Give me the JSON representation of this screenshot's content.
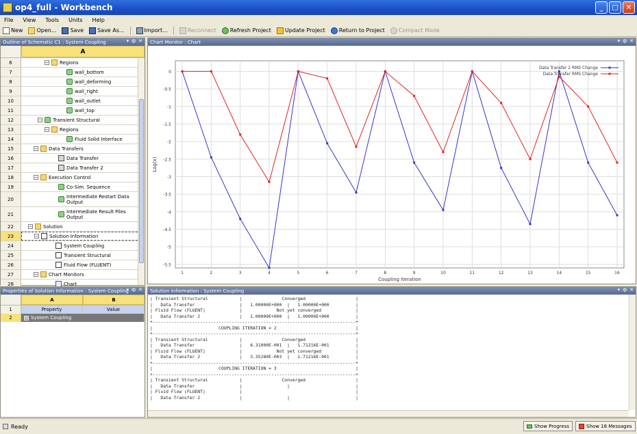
{
  "window": {
    "title": "op4_full - Workbench",
    "minimize": "_",
    "maximize": "□",
    "close": "✕"
  },
  "menu": [
    "File",
    "View",
    "Tools",
    "Units",
    "Help"
  ],
  "toolbar": {
    "new": "New",
    "open": "Open...",
    "save": "Save",
    "save_as": "Save As...",
    "import": "Import...",
    "reconnect": "Reconnect",
    "refresh": "Refresh Project",
    "update": "Update Project",
    "return": "Return to Project",
    "compact": "Compact Mode"
  },
  "outline": {
    "title": "Outline of Schematic C1 : System Coupling",
    "col": "A",
    "rows": [
      {
        "num": "6",
        "label": "Regions",
        "indent": 34,
        "toggle": "⊟",
        "icon": "folder"
      },
      {
        "num": "7",
        "label": "wall_bottom",
        "indent": 56,
        "icon": "green"
      },
      {
        "num": "8",
        "label": "wall_deforming",
        "indent": 56,
        "icon": "green"
      },
      {
        "num": "9",
        "label": "wall_right",
        "indent": 56,
        "icon": "green"
      },
      {
        "num": "10",
        "label": "wall_outlet",
        "indent": 56,
        "icon": "green"
      },
      {
        "num": "11",
        "label": "wall_top",
        "indent": 56,
        "icon": "green"
      },
      {
        "num": "12",
        "label": "Transient Structural",
        "indent": 24,
        "toggle": "⊟",
        "icon": "green"
      },
      {
        "num": "13",
        "label": "Regions",
        "indent": 34,
        "toggle": "⊟",
        "icon": "folder"
      },
      {
        "num": "14",
        "label": "Fluid Solid Interface",
        "indent": 56,
        "icon": "green"
      },
      {
        "num": "15",
        "label": "Data Transfers",
        "indent": 18,
        "toggle": "⊟",
        "icon": "folder"
      },
      {
        "num": "16",
        "label": "Data Transfer",
        "indent": 44,
        "icon": "xfer"
      },
      {
        "num": "17",
        "label": "Data Transfer 2",
        "indent": 44,
        "icon": "xfer"
      },
      {
        "num": "18",
        "label": "Execution Control",
        "indent": 18,
        "toggle": "⊟",
        "icon": "folder"
      },
      {
        "num": "19",
        "label": "Co-Sim. Sequence",
        "indent": 44,
        "icon": "green"
      },
      {
        "num": "20",
        "label": "Intermediate Restart Data Output",
        "indent": 44,
        "icon": "green",
        "tall": true
      },
      {
        "num": "21",
        "label": "Intermediate Result Files Output",
        "indent": 44,
        "icon": "green",
        "tall": true
      },
      {
        "num": "22",
        "label": "Solution",
        "indent": 10,
        "toggle": "⊟",
        "icon": "folder"
      },
      {
        "num": "23",
        "label": "Solution Information",
        "indent": 18,
        "toggle": "⊟",
        "icon": "doc",
        "selected": true
      },
      {
        "num": "24",
        "label": "System Coupling",
        "indent": 40,
        "icon": "doc"
      },
      {
        "num": "25",
        "label": "Transient Structural",
        "indent": 40,
        "icon": "doc"
      },
      {
        "num": "26",
        "label": "Fluid Flow (FLUENT)",
        "indent": 40,
        "icon": "doc"
      },
      {
        "num": "27",
        "label": "Chart Monitors",
        "indent": 18,
        "toggle": "⊟",
        "icon": "folder"
      },
      {
        "num": "28",
        "label": "Chart",
        "indent": 40,
        "icon": "chart"
      }
    ]
  },
  "properties": {
    "title": "Properties of Solution Information : System Coupling",
    "col_a": "A",
    "col_b": "B",
    "rows": [
      {
        "num": "1",
        "a": "Property",
        "b": "Value"
      },
      {
        "num": "2",
        "a": "System Coupling",
        "b": ""
      }
    ]
  },
  "chart_panel": {
    "title": "Chart Monitor : Chart"
  },
  "chart_data": {
    "type": "line",
    "xlabel": "Coupling Iteration",
    "ylabel": "Log(x)",
    "x": [
      1,
      2,
      3,
      4,
      5,
      6,
      7,
      8,
      9,
      10,
      11,
      12,
      13,
      14,
      15,
      16
    ],
    "ylim": [
      -5.6,
      0.3
    ],
    "yticks": [
      0,
      -0.5,
      -1,
      -1.5,
      -2,
      -2.5,
      -3,
      -3.5,
      -4,
      -4.5,
      -5,
      -5.5
    ],
    "grid": true,
    "legend": "top-right",
    "series": [
      {
        "name": "Data Transfer 2 RMS Change",
        "color": "#3333cc",
        "values": [
          0,
          -2.45,
          -4.2,
          -5.6,
          0,
          -2.05,
          -3.45,
          0,
          -2.6,
          -3.95,
          0,
          -2.75,
          -4.35,
          0,
          -2.6,
          -4.1
        ]
      },
      {
        "name": "Data Transfer RMS Change",
        "color": "#dd2222",
        "values": [
          0,
          0,
          -1.8,
          -3.15,
          0,
          -0.2,
          -2.15,
          0,
          -0.7,
          -2.3,
          0,
          -0.9,
          -2.5,
          -0.15,
          -1.0,
          -2.6
        ]
      }
    ]
  },
  "solution_panel": {
    "title": "Solution Information : System Coupling",
    "lines": [
      "| Transient Structural            |               Converged                   |",
      "|   Data Transfer                 |   1.00000E+000  |   1.00000E+000          |",
      "| Fluid Flow (FLUENT)             |             Not yet converged             |",
      "|   Data Transfer 2               |   1.00000E+000  |   1.00000E+000          |",
      "+-----------------------------------------------------------------------------+",
      "|                         COUPLING ITERATION = 2                              |",
      "+-----------------------------------------------------------------------------+",
      "| Transient Structural            |               Converged                   |",
      "|   Data Transfer                 |   6.31000E-001  |   1.71216E-001          |",
      "| Fluid Flow (FLUENT)             |             Not yet converged             |",
      "|   Data Transfer 2               |   3.35280E-003  |   1.71216E-001          |",
      "+-----------------------------------------------------------------------------+",
      "|                         COUPLING ITERATION = 3                              |",
      "+-----------------------------------------------------------------------------+",
      "| Transient Structural            |               Converged                   |",
      "|   Data Transfer                 |                 |                         |",
      "| Fluid Flow (FLUENT)             |                                           |",
      "|   Data Transfer 2               |                 |                         |"
    ]
  },
  "status": {
    "text": "Ready",
    "progress_button": "Show Progress",
    "messages_button": "Show 18 Messages"
  },
  "colors": {
    "title_bar": "#1b4fc7",
    "selected_col": "#f7e27a",
    "panel_header": "#566a92"
  }
}
